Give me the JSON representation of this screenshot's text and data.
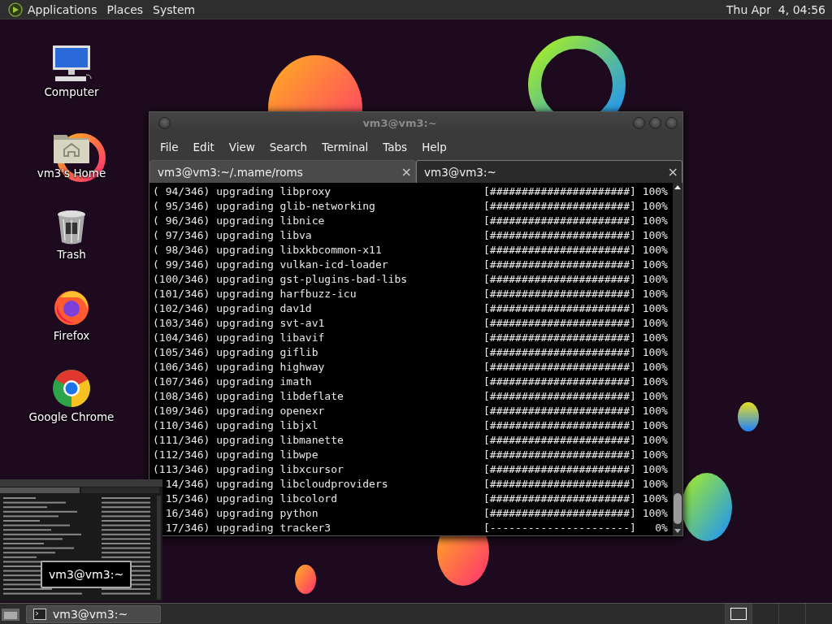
{
  "top_panel": {
    "menus": [
      "Applications",
      "Places",
      "System"
    ],
    "clock": "Thu Apr  4, 04:56"
  },
  "desktop_icons": [
    {
      "label": "Computer",
      "kind": "computer"
    },
    {
      "label": "vm3's Home",
      "kind": "home"
    },
    {
      "label": "Trash",
      "kind": "trash"
    },
    {
      "label": "Firefox",
      "kind": "firefox"
    },
    {
      "label": "Google Chrome",
      "kind": "chrome"
    }
  ],
  "terminal": {
    "title": "vm3@vm3:~",
    "menu": [
      "File",
      "Edit",
      "View",
      "Search",
      "Terminal",
      "Tabs",
      "Help"
    ],
    "tabs": [
      {
        "label": "vm3@vm3:~/.mame/roms",
        "close": "×",
        "selected": false
      },
      {
        "label": "vm3@vm3:~",
        "close": "×",
        "selected": true
      }
    ],
    "lines": [
      {
        "text": "( 94/346) upgrading libproxy",
        "bar": "[######################]",
        "percent": "100%",
        "clipped": false
      },
      {
        "text": "( 95/346) upgrading glib-networking",
        "bar": "[######################]",
        "percent": "100%",
        "clipped": false
      },
      {
        "text": "( 96/346) upgrading libnice",
        "bar": "[######################]",
        "percent": "100%",
        "clipped": false
      },
      {
        "text": "( 97/346) upgrading libva",
        "bar": "[######################]",
        "percent": "100%",
        "clipped": false
      },
      {
        "text": "( 98/346) upgrading libxkbcommon-x11",
        "bar": "[######################]",
        "percent": "100%",
        "clipped": false
      },
      {
        "text": "( 99/346) upgrading vulkan-icd-loader",
        "bar": "[######################]",
        "percent": "100%",
        "clipped": false
      },
      {
        "text": "(100/346) upgrading gst-plugins-bad-libs",
        "bar": "[######################]",
        "percent": "100%",
        "clipped": false
      },
      {
        "text": "(101/346) upgrading harfbuzz-icu",
        "bar": "[######################]",
        "percent": "100%",
        "clipped": false
      },
      {
        "text": "(102/346) upgrading dav1d",
        "bar": "[######################]",
        "percent": "100%",
        "clipped": false
      },
      {
        "text": "(103/346) upgrading svt-av1",
        "bar": "[######################]",
        "percent": "100%",
        "clipped": false
      },
      {
        "text": "(104/346) upgrading libavif",
        "bar": "[######################]",
        "percent": "100%",
        "clipped": false
      },
      {
        "text": "(105/346) upgrading giflib",
        "bar": "[######################]",
        "percent": "100%",
        "clipped": false
      },
      {
        "text": "(106/346) upgrading highway",
        "bar": "[######################]",
        "percent": "100%",
        "clipped": false
      },
      {
        "text": "(107/346) upgrading imath",
        "bar": "[######################]",
        "percent": "100%",
        "clipped": false
      },
      {
        "text": "(108/346) upgrading libdeflate",
        "bar": "[######################]",
        "percent": "100%",
        "clipped": false
      },
      {
        "text": "(109/346) upgrading openexr",
        "bar": "[######################]",
        "percent": "100%",
        "clipped": false
      },
      {
        "text": "(110/346) upgrading libjxl",
        "bar": "[######################]",
        "percent": "100%",
        "clipped": false
      },
      {
        "text": "(111/346) upgrading libmanette",
        "bar": "[######################]",
        "percent": "100%",
        "clipped": false
      },
      {
        "text": "(112/346) upgrading libwpe",
        "bar": "[######################]",
        "percent": "100%",
        "clipped": false
      },
      {
        "text": "(113/346) upgrading libxcursor",
        "bar": "[######################]",
        "percent": "100%",
        "clipped": false
      },
      {
        "text": "14/346) upgrading libcloudproviders",
        "bar": "[######################]",
        "percent": "100%",
        "clipped": true
      },
      {
        "text": "15/346) upgrading libcolord",
        "bar": "[######################]",
        "percent": "100%",
        "clipped": true
      },
      {
        "text": "16/346) upgrading python",
        "bar": "[######################]",
        "percent": "100%",
        "clipped": true
      },
      {
        "text": "17/346) upgrading tracker3",
        "bar": "[----------------------]",
        "percent": "0%",
        "clipped": true
      }
    ]
  },
  "window_preview": {
    "tooltip": "vm3@vm3:~"
  },
  "taskbar": {
    "tasks": [
      {
        "label": "vm3@vm3:~"
      }
    ],
    "workspaces": [
      {
        "selected": true
      },
      {
        "selected": false
      },
      {
        "selected": false
      },
      {
        "selected": false
      }
    ]
  }
}
